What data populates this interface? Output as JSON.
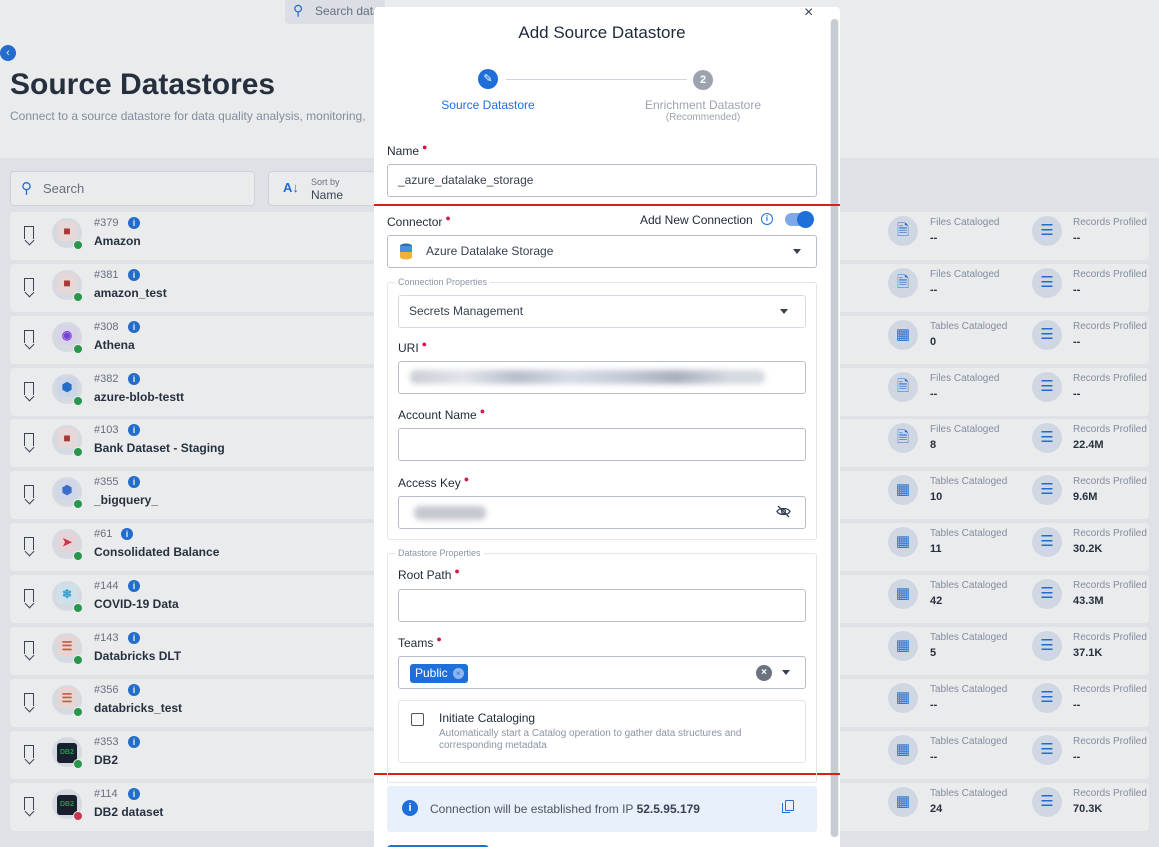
{
  "background": {
    "top_search_placeholder": "Search data",
    "page_title": "Source Datastores",
    "page_subtitle": "Connect to a source datastore for data quality analysis, monitoring,",
    "list_search_placeholder": "Search",
    "sort": {
      "label": "Sort by",
      "value": "Name"
    },
    "rows": [
      {
        "id": "#379",
        "name": "Amazon",
        "logo": "cube-icon",
        "status": "green",
        "c1_label": "Files Cataloged",
        "c1_value": "--",
        "c1_icon": "file-icon",
        "c2_label": "Records Profiled",
        "c2_value": "--"
      },
      {
        "id": "#381",
        "name": "amazon_test",
        "logo": "cube-icon",
        "status": "green",
        "c1_label": "Files Cataloged",
        "c1_value": "--",
        "c1_icon": "file-icon",
        "c2_label": "Records Profiled",
        "c2_value": "--"
      },
      {
        "id": "#308",
        "name": "Athena",
        "logo": "athena-icon",
        "status": "green",
        "c1_label": "Tables Cataloged",
        "c1_value": "0",
        "c1_icon": "table-icon",
        "c2_label": "Records Profiled",
        "c2_value": "--"
      },
      {
        "id": "#382",
        "name": "azure-blob-testt",
        "logo": "azure-icon",
        "status": "green",
        "c1_label": "Files Cataloged",
        "c1_value": "--",
        "c1_icon": "file-icon",
        "c2_label": "Records Profiled",
        "c2_value": "--"
      },
      {
        "id": "#103",
        "name": "Bank Dataset - Staging",
        "logo": "cube-icon",
        "status": "green",
        "c1_label": "Files Cataloged",
        "c1_value": "8",
        "c1_icon": "file-icon",
        "c2_label": "Records Profiled",
        "c2_value": "22.4M"
      },
      {
        "id": "#355",
        "name": "_bigquery_",
        "logo": "bigquery-icon",
        "status": "green",
        "c1_label": "Tables Cataloged",
        "c1_value": "10",
        "c1_icon": "table-icon",
        "c2_label": "Records Profiled",
        "c2_value": "9.6M"
      },
      {
        "id": "#61",
        "name": "Consolidated Balance",
        "logo": "redshift-icon",
        "status": "green",
        "c1_label": "Tables Cataloged",
        "c1_value": "11",
        "c1_icon": "table-icon",
        "c2_label": "Records Profiled",
        "c2_value": "30.2K"
      },
      {
        "id": "#144",
        "name": "COVID-19 Data",
        "logo": "snowflake-icon",
        "status": "green",
        "c1_label": "Tables Cataloged",
        "c1_value": "42",
        "c1_icon": "table-icon",
        "c2_label": "Records Profiled",
        "c2_value": "43.3M"
      },
      {
        "id": "#143",
        "name": "Databricks DLT",
        "logo": "databricks-icon",
        "status": "green",
        "c1_label": "Tables Cataloged",
        "c1_value": "5",
        "c1_icon": "table-icon",
        "c2_label": "Records Profiled",
        "c2_value": "37.1K"
      },
      {
        "id": "#356",
        "name": "databricks_test",
        "logo": "databricks-icon",
        "status": "green",
        "c1_label": "Tables Cataloged",
        "c1_value": "--",
        "c1_icon": "table-icon",
        "c2_label": "Records Profiled",
        "c2_value": "--"
      },
      {
        "id": "#353",
        "name": "DB2",
        "logo": "db2-icon",
        "status": "green",
        "c1_label": "Tables Cataloged",
        "c1_value": "--",
        "c1_icon": "table-icon",
        "c2_label": "Records Profiled",
        "c2_value": "--"
      },
      {
        "id": "#114",
        "name": "DB2 dataset",
        "logo": "db2-icon",
        "status": "red",
        "c1_label": "Tables Cataloged",
        "c1_value": "24",
        "c1_icon": "table-icon",
        "c2_label": "Records Profiled",
        "c2_value": "70.3K"
      }
    ]
  },
  "modal": {
    "title": "Add Source Datastore",
    "close_icon": "close-icon",
    "steps": [
      {
        "label": "Source Datastore",
        "badge": "pencil-icon"
      },
      {
        "label": "Enrichment Datastore",
        "sub": "(Recommended)",
        "badge": "2"
      }
    ],
    "name_label": "Name",
    "name_value": "_azure_datalake_storage",
    "connector_label": "Connector",
    "add_new_connection_label": "Add New Connection",
    "add_new_connection_on": true,
    "connector_value": "Azure Datalake Storage",
    "connection_properties_legend": "Connection Properties",
    "secrets_value": "Secrets Management",
    "uri_label": "URI",
    "account_name_label": "Account Name",
    "account_name_value": "",
    "access_key_label": "Access Key",
    "datastore_properties_legend": "Datastore Properties",
    "root_path_label": "Root Path",
    "root_path_value": "",
    "teams_label": "Teams",
    "teams_chip": "Public",
    "initiate_cataloging_label": "Initiate Cataloging",
    "initiate_cataloging_desc": "Automatically start a Catalog operation to gather data structures and corresponding metadata",
    "initiate_cataloging_checked": false,
    "ip_banner_text": "Connection will be established from IP",
    "ip_address": "52.5.95.179"
  }
}
